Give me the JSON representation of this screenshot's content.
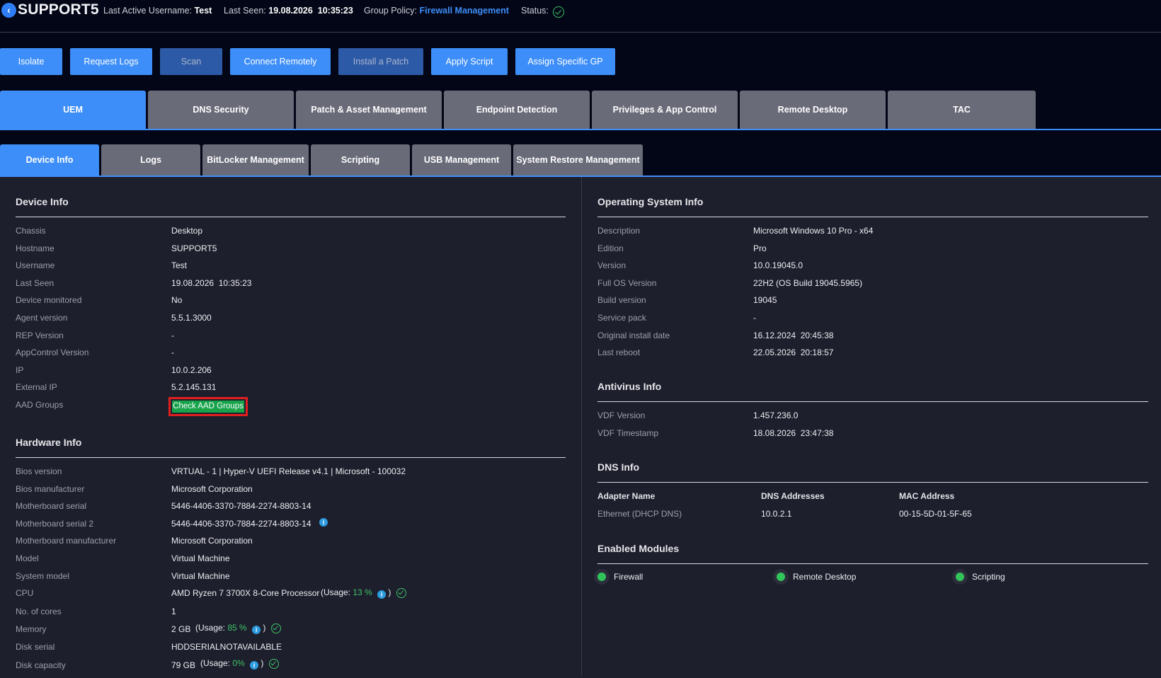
{
  "header": {
    "device_name": "SUPPORT5",
    "last_active_label": "Last Active Username:",
    "last_active_value": "Test",
    "last_seen_label": "Last Seen:",
    "last_seen_value": "19.08.2026  10:35:23",
    "group_policy_label": "Group Policy:",
    "group_policy_value": "Firewall Management",
    "status_label": "Status:",
    "back_icon": "chevron-left-icon",
    "status_icon": "check-circle-icon"
  },
  "actions": [
    {
      "label": "Isolate",
      "enabled": true
    },
    {
      "label": "Request Logs",
      "enabled": true
    },
    {
      "label": "Scan",
      "enabled": false
    },
    {
      "label": "Connect Remotely",
      "enabled": true
    },
    {
      "label": "Install a Patch",
      "enabled": false
    },
    {
      "label": "Apply Script",
      "enabled": true
    },
    {
      "label": "Assign Specific GP",
      "enabled": true
    }
  ],
  "main_tabs": [
    "UEM",
    "DNS Security",
    "Patch & Asset Management",
    "Endpoint Detection",
    "Privileges & App Control",
    "Remote Desktop",
    "TAC"
  ],
  "main_tab_active": "UEM",
  "sub_tabs": [
    "Device Info",
    "Logs",
    "BitLocker Management",
    "Scripting",
    "USB Management",
    "System Restore Management"
  ],
  "sub_tab_active": "Device Info",
  "device_info": {
    "title": "Device Info",
    "rows": [
      {
        "label": "Chassis",
        "value": "Desktop"
      },
      {
        "label": "Hostname",
        "value": "SUPPORT5"
      },
      {
        "label": "Username",
        "value": "Test"
      },
      {
        "label": "Last Seen",
        "value": "19.08.2026  10:35:23"
      },
      {
        "label": "Device monitored",
        "value": "No"
      },
      {
        "label": "Agent version",
        "value": "5.5.1.3000"
      },
      {
        "label": "REP Version",
        "value": "-"
      },
      {
        "label": "AppControl Version",
        "value": "-"
      },
      {
        "label": "IP",
        "value": "10.0.2.206"
      },
      {
        "label": "External IP",
        "value": "5.2.145.131"
      },
      {
        "label": "AAD Groups",
        "value": ""
      }
    ],
    "aad_button": "Check AAD Groups"
  },
  "hardware_info": {
    "title": "Hardware Info",
    "rows": [
      {
        "label": "Bios version",
        "value": "VRTUAL - 1 | Hyper-V UEFI Release v4.1 | Microsoft - 100032"
      },
      {
        "label": "Bios manufacturer",
        "value": "Microsoft Corporation"
      },
      {
        "label": "Motherboard serial",
        "value": "5446-4406-3370-7884-2274-8803-14"
      },
      {
        "label": "Motherboard serial 2",
        "value": "5446-4406-3370-7884-2274-8803-14"
      },
      {
        "label": "Motherboard manufacturer",
        "value": "Microsoft Corporation"
      },
      {
        "label": "Model",
        "value": "Virtual Machine"
      },
      {
        "label": "System model",
        "value": "Virtual Machine"
      },
      {
        "label": "CPU",
        "value": "AMD Ryzen 7 3700X 8-Core Processor"
      },
      {
        "label": "No. of cores",
        "value": "1"
      },
      {
        "label": "Memory",
        "value": "2 GB"
      },
      {
        "label": "Disk serial",
        "value": "HDDSERIALNOTAVAILABLE"
      },
      {
        "label": "Disk capacity",
        "value": "79 GB"
      }
    ],
    "usage_prefix": "(Usage:",
    "usage_suffix": ")",
    "cpu_usage": "13 %",
    "memory_usage": "85 %",
    "disk_usage": "0%",
    "info_glyph": "i"
  },
  "os_info": {
    "title": "Operating System Info",
    "rows": [
      {
        "label": "Description",
        "value": "Microsoft Windows 10 Pro - x64"
      },
      {
        "label": "Edition",
        "value": "Pro"
      },
      {
        "label": "Version",
        "value": "10.0.19045.0"
      },
      {
        "label": "Full OS Version",
        "value": "22H2 (OS Build 19045.5965)"
      },
      {
        "label": "Build version",
        "value": "19045"
      },
      {
        "label": "Service pack",
        "value": "-"
      },
      {
        "label": "Original install date",
        "value": "16.12.2024  20:45:38"
      },
      {
        "label": "Last reboot",
        "value": "22.05.2026  20:18:57"
      }
    ]
  },
  "antivirus_info": {
    "title": "Antivirus Info",
    "rows": [
      {
        "label": "VDF Version",
        "value": "1.457.236.0"
      },
      {
        "label": "VDF Timestamp",
        "value": "18.08.2026  23:47:38"
      }
    ]
  },
  "dns_info": {
    "title": "DNS Info",
    "headers": [
      "Adapter Name",
      "DNS Addresses",
      "MAC Address"
    ],
    "rows": [
      [
        "Ethernet (DHCP DNS)",
        "10.0.2.1",
        "00-15-5D-01-5F-65"
      ]
    ]
  },
  "modules": {
    "title": "Enabled Modules",
    "items": [
      "Firewall",
      "Remote Desktop",
      "Scripting"
    ],
    "status_color": "#31c45a"
  },
  "colors": {
    "accent": "#3d8ef8",
    "ok": "#3ec267",
    "highlight": "#e02020",
    "aad_button": "#16a34a"
  }
}
